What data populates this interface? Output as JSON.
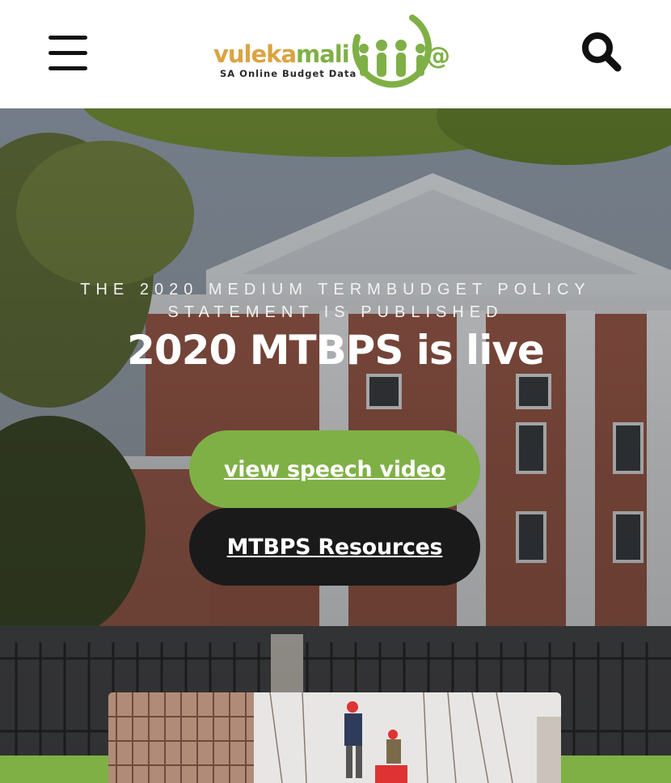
{
  "header": {
    "logo": {
      "word_part1": "vuleka",
      "word_part2": "mali",
      "tagline": "SA Online Budget Data"
    },
    "menu_icon": "hamburger-menu-icon",
    "search_icon": "search-icon"
  },
  "hero": {
    "kicker": "THE 2020 MEDIUM TERMBUDGET POLICY STATEMENT IS PUBLISHED",
    "headline": "2020 MTBPS is live",
    "primary_button": "view speech video",
    "secondary_button": "MTBPS Resources"
  },
  "colors": {
    "brand_green": "#7fb046",
    "brand_gold": "#d9a441",
    "dark_button": "#1a1a1a"
  }
}
